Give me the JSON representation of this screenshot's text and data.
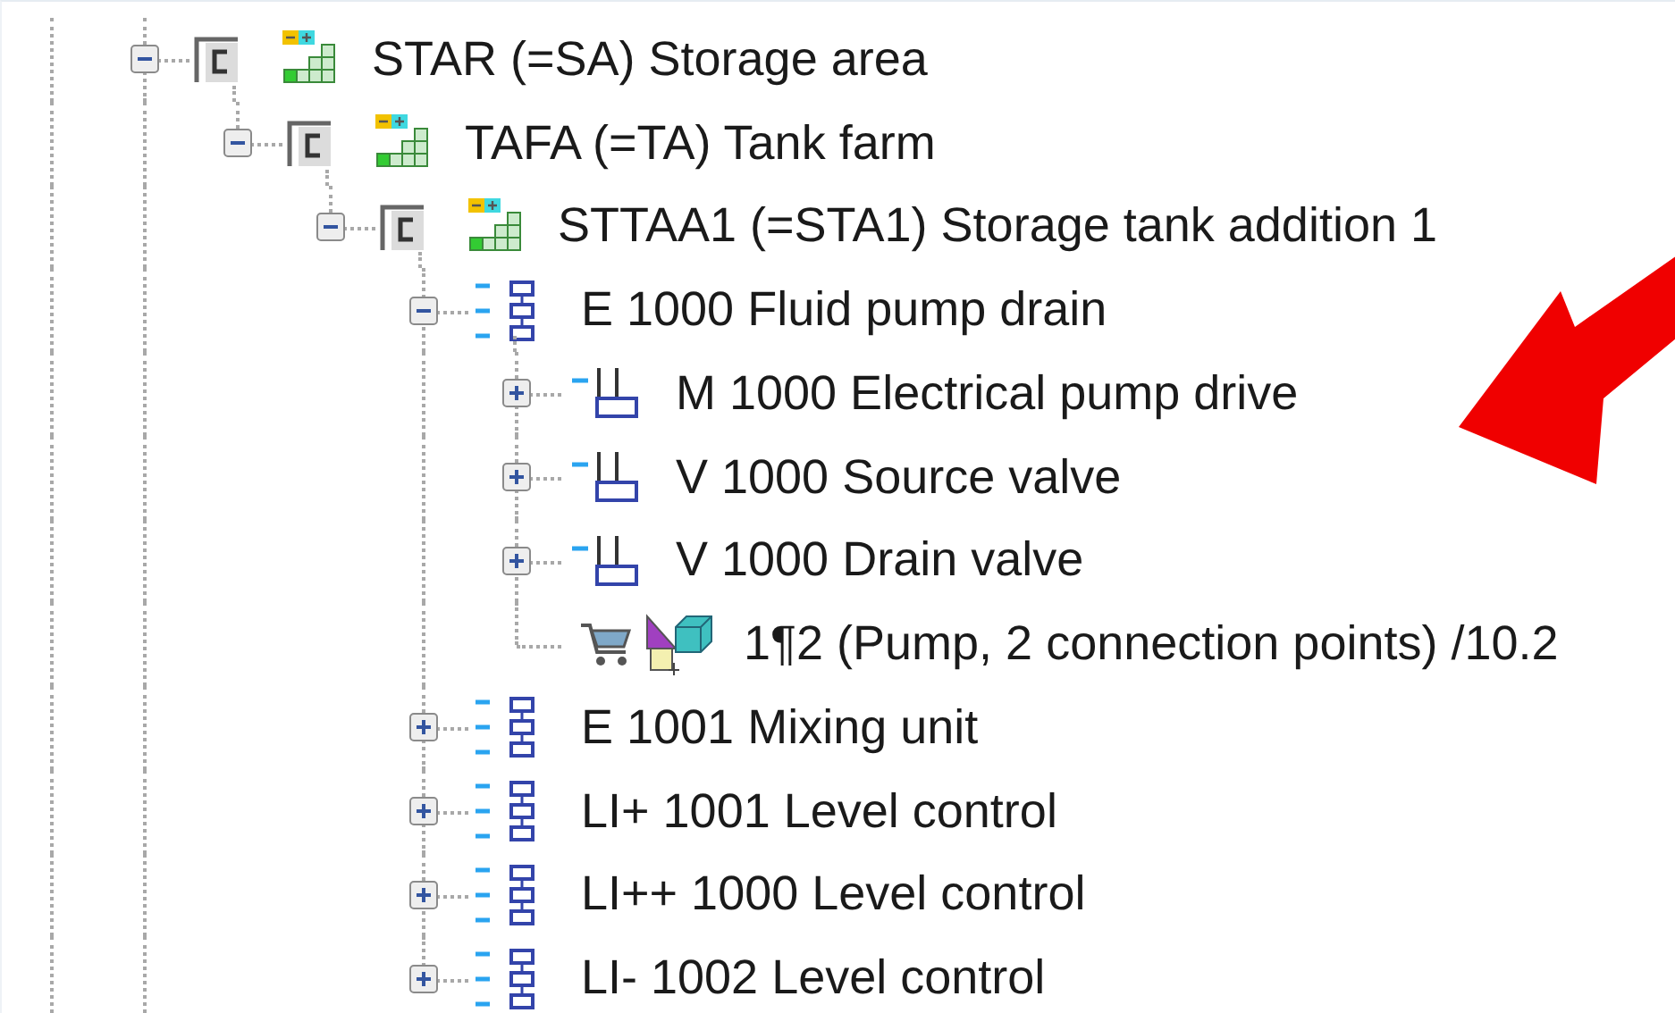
{
  "tree": [
    {
      "kind": "location",
      "label": "STAR (=SA) Storage area",
      "expanded": true,
      "children": [
        {
          "kind": "location",
          "label": "TAFA (=TA) Tank farm",
          "expanded": true,
          "children": [
            {
              "kind": "location",
              "label": "STTAA1 (=STA1) Storage tank addition 1",
              "expanded": true,
              "children": [
                {
                  "kind": "function",
                  "label": "E 1000 Fluid pump drain",
                  "expanded": true,
                  "children": [
                    {
                      "kind": "device",
                      "label": "M 1000 Electrical pump drive",
                      "expanded": false
                    },
                    {
                      "kind": "device",
                      "label": "V 1000 Source valve",
                      "expanded": false
                    },
                    {
                      "kind": "device",
                      "label": "V 1000 Drain valve",
                      "expanded": false
                    },
                    {
                      "kind": "part",
                      "label": "1¶2 (Pump, 2 connection points) /10.2"
                    }
                  ]
                },
                {
                  "kind": "function",
                  "label": "E 1001 Mixing unit",
                  "expanded": false
                },
                {
                  "kind": "function",
                  "label": "LI+ 1001 Level control",
                  "expanded": false
                },
                {
                  "kind": "function",
                  "label": "LI++ 1000 Level control",
                  "expanded": false
                },
                {
                  "kind": "function",
                  "label": "LI- 1002 Level control",
                  "expanded": false
                }
              ]
            }
          ]
        }
      ]
    }
  ]
}
